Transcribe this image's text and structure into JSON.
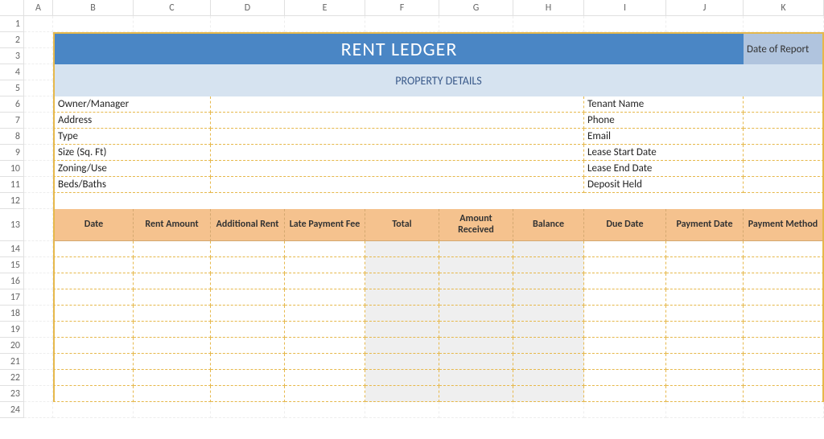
{
  "columns": [
    "A",
    "B",
    "C",
    "D",
    "E",
    "F",
    "G",
    "H",
    "I",
    "J",
    "K"
  ],
  "row_numbers": [
    "1",
    "2",
    "3",
    "4",
    "5",
    "6",
    "7",
    "8",
    "9",
    "10",
    "11",
    "12",
    "13",
    "14",
    "15",
    "16",
    "17",
    "18",
    "19",
    "20",
    "21",
    "22",
    "23",
    "24"
  ],
  "title": "RENT LEDGER",
  "date_of_report_label": "Date of Report",
  "section_header": "PROPERTY DETAILS",
  "property_left_labels": [
    "Owner/Manager",
    "Address",
    "Type",
    "Size (Sq. Ft)",
    "Zoning/Use",
    "Beds/Baths"
  ],
  "property_right_labels": [
    "Tenant Name",
    "Phone",
    "Email",
    "Lease Start Date",
    "Lease End Date",
    "Deposit Held"
  ],
  "table_headers": [
    "Date",
    "Rent Amount",
    "Additional Rent",
    "Late Payment Fee",
    "Total",
    "Amount Received",
    "Balance",
    "Due Date",
    "Payment Date",
    "Payment Method"
  ],
  "chart_data": {
    "type": "table",
    "title": "Rent Ledger",
    "columns": [
      "Date",
      "Rent Amount",
      "Additional Rent",
      "Late Payment Fee",
      "Total",
      "Amount Received",
      "Balance",
      "Due Date",
      "Payment Date",
      "Payment Method"
    ],
    "rows": []
  }
}
